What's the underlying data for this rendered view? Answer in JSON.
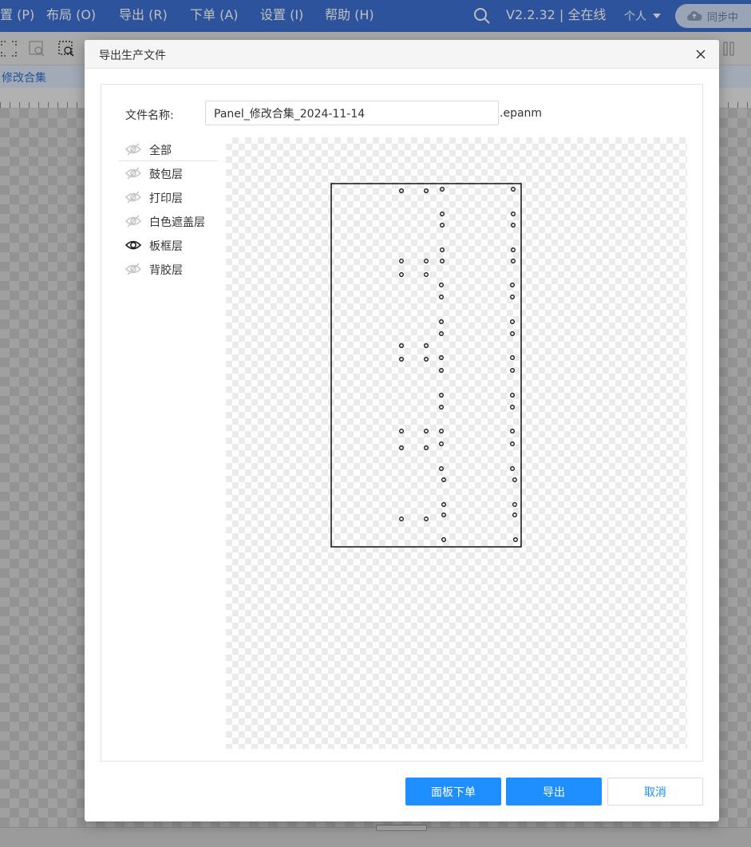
{
  "menubar": {
    "items": [
      "置 (P)",
      "布局 (O)",
      "导出 (R)",
      "下单 (A)",
      "设置 (I)",
      "帮助 (H)"
    ],
    "version_status": "V2.2.32 | 全在线",
    "user_menu": "个人",
    "sync_label": "同步中"
  },
  "tab": {
    "label": "修改合集"
  },
  "dialog": {
    "title": "导出生产文件",
    "filename_label": "文件名称:",
    "filename_value": "Panel_修改合集_2024-11-14",
    "extension": ".epanm",
    "layers": [
      {
        "label": "全部",
        "visible": false
      },
      {
        "label": "鼓包层",
        "visible": false
      },
      {
        "label": "打印层",
        "visible": false
      },
      {
        "label": "白色遮盖层",
        "visible": false
      },
      {
        "label": "板框层",
        "visible": true
      },
      {
        "label": "背胶层",
        "visible": false
      }
    ],
    "buttons": {
      "panel_order": "面板下单",
      "export": "导出",
      "cancel": "取消"
    }
  },
  "colors": {
    "menubar_bg": "#3c6fd1",
    "primary": "#1f8fff",
    "eye_hidden": "#c4c4c4",
    "eye_visible": "#222222"
  },
  "icons": {
    "search": "search-icon",
    "close": "close-icon",
    "eye_open": "eye-icon",
    "eye_hidden": "eye-off-icon",
    "cloud_sync": "cloud-sync-icon"
  }
}
